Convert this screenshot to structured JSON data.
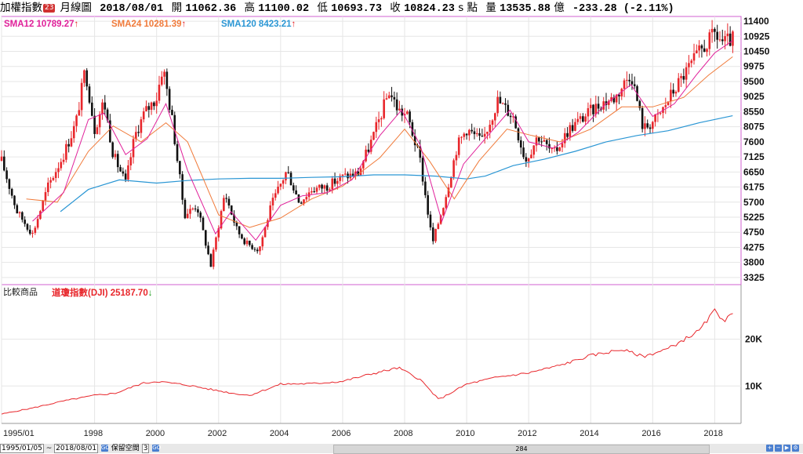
{
  "header": {
    "index_name": "加權指數",
    "badge": "23",
    "period": "月線圖",
    "date": "2018/08/01",
    "open_label": "開",
    "open": "11062.36",
    "high_label": "高",
    "high": "11100.02",
    "low_label": "低",
    "low": "10693.73",
    "close_label": "收",
    "close": "10824.23",
    "unit": "s 點",
    "volume_label": "量",
    "volume": "13535.88",
    "volume_unit": "億",
    "change": "-233.28 (-2.11%)"
  },
  "legend": {
    "sma12": "SMA12 10789.27",
    "sma24": "SMA24 10281.39",
    "sma120": "SMA120 8423.21",
    "arrow_up": "↑",
    "arrow_down": "↓",
    "compare_label": "比較商品",
    "compare_series": "道瓊指數(DJI) 25187.70"
  },
  "colors": {
    "up": "#e8262b",
    "down": "#111111",
    "sma12": "#e0209a",
    "sma24": "#f07a3a",
    "sma120": "#2a96d4",
    "dji": "#e8262b",
    "frame": "#d060d0",
    "arrow_up": "#e8262b",
    "arrow_down": "#1a9a1a"
  },
  "bottom": {
    "start_date": "1995/01/05",
    "tilde": "~",
    "end_date": "2018/08/01",
    "go": "GO",
    "keep_space_label": "保留空間",
    "keep_space_value": "3",
    "scroll_value": "284"
  },
  "chart_data": [
    {
      "type": "candlestick",
      "title": "加權指數 月線圖",
      "x_tick_labels": [
        "1995/01",
        "1998",
        "2000",
        "2002",
        "2004",
        "2006",
        "2008",
        "2010",
        "2012",
        "2014",
        "2016",
        "2018"
      ],
      "y_tick_labels": [
        "11400",
        "10925",
        "10450",
        "9975",
        "9500",
        "9025",
        "8550",
        "8075",
        "7600",
        "7125",
        "6650",
        "6175",
        "5700",
        "5225",
        "4750",
        "4275",
        "3800",
        "3325"
      ],
      "ylim": [
        3100,
        11550
      ],
      "series": [
        {
          "name": "SMA12",
          "value": 10789.27
        },
        {
          "name": "SMA24",
          "value": 10281.39
        },
        {
          "name": "SMA120",
          "value": 8423.21
        }
      ],
      "close_points": [
        {
          "x": 1995.0,
          "y": 7000
        },
        {
          "x": 1995.5,
          "y": 5400
        },
        {
          "x": 1996.0,
          "y": 4700
        },
        {
          "x": 1996.5,
          "y": 6200
        },
        {
          "x": 1997.0,
          "y": 7200
        },
        {
          "x": 1997.4,
          "y": 8200
        },
        {
          "x": 1997.7,
          "y": 9900
        },
        {
          "x": 1998.0,
          "y": 8000
        },
        {
          "x": 1998.3,
          "y": 8900
        },
        {
          "x": 1998.6,
          "y": 7200
        },
        {
          "x": 1999.0,
          "y": 6300
        },
        {
          "x": 1999.3,
          "y": 7800
        },
        {
          "x": 1999.6,
          "y": 8500
        },
        {
          "x": 2000.0,
          "y": 9000
        },
        {
          "x": 2000.2,
          "y": 10000
        },
        {
          "x": 2000.5,
          "y": 8300
        },
        {
          "x": 2000.9,
          "y": 5300
        },
        {
          "x": 2001.3,
          "y": 5600
        },
        {
          "x": 2001.75,
          "y": 3700
        },
        {
          "x": 2002.2,
          "y": 6000
        },
        {
          "x": 2002.6,
          "y": 4800
        },
        {
          "x": 2002.9,
          "y": 4400
        },
        {
          "x": 2003.3,
          "y": 4200
        },
        {
          "x": 2003.7,
          "y": 5600
        },
        {
          "x": 2004.2,
          "y": 6700
        },
        {
          "x": 2004.6,
          "y": 5700
        },
        {
          "x": 2005.0,
          "y": 6100
        },
        {
          "x": 2005.5,
          "y": 6200
        },
        {
          "x": 2006.0,
          "y": 6500
        },
        {
          "x": 2006.5,
          "y": 6600
        },
        {
          "x": 2007.0,
          "y": 7800
        },
        {
          "x": 2007.5,
          "y": 9200
        },
        {
          "x": 2007.8,
          "y": 8600
        },
        {
          "x": 2008.1,
          "y": 8400
        },
        {
          "x": 2008.5,
          "y": 7000
        },
        {
          "x": 2008.9,
          "y": 4400
        },
        {
          "x": 2009.3,
          "y": 5800
        },
        {
          "x": 2009.7,
          "y": 7500
        },
        {
          "x": 2010.0,
          "y": 8000
        },
        {
          "x": 2010.5,
          "y": 7600
        },
        {
          "x": 2011.0,
          "y": 8900
        },
        {
          "x": 2011.5,
          "y": 8400
        },
        {
          "x": 2011.9,
          "y": 7000
        },
        {
          "x": 2012.3,
          "y": 7800
        },
        {
          "x": 2012.8,
          "y": 7200
        },
        {
          "x": 2013.3,
          "y": 8000
        },
        {
          "x": 2013.8,
          "y": 8400
        },
        {
          "x": 2014.3,
          "y": 8800
        },
        {
          "x": 2014.8,
          "y": 9000
        },
        {
          "x": 2015.3,
          "y": 9800
        },
        {
          "x": 2015.7,
          "y": 8000
        },
        {
          "x": 2016.2,
          "y": 8400
        },
        {
          "x": 2016.6,
          "y": 9100
        },
        {
          "x": 2017.0,
          "y": 9700
        },
        {
          "x": 2017.5,
          "y": 10400
        },
        {
          "x": 2018.0,
          "y": 11000
        },
        {
          "x": 2018.3,
          "y": 10700
        },
        {
          "x": 2018.58,
          "y": 10824
        }
      ],
      "sma12_points": [
        {
          "x": 1996.0,
          "y": 5100
        },
        {
          "x": 1997.0,
          "y": 6000
        },
        {
          "x": 1997.8,
          "y": 8300
        },
        {
          "x": 1998.3,
          "y": 8500
        },
        {
          "x": 1999.0,
          "y": 7200
        },
        {
          "x": 1999.7,
          "y": 7700
        },
        {
          "x": 2000.3,
          "y": 8800
        },
        {
          "x": 2001.0,
          "y": 6700
        },
        {
          "x": 2001.9,
          "y": 4700
        },
        {
          "x": 2002.4,
          "y": 5400
        },
        {
          "x": 2003.2,
          "y": 4500
        },
        {
          "x": 2004.0,
          "y": 5600
        },
        {
          "x": 2004.7,
          "y": 5900
        },
        {
          "x": 2005.5,
          "y": 6000
        },
        {
          "x": 2006.3,
          "y": 6400
        },
        {
          "x": 2007.2,
          "y": 7800
        },
        {
          "x": 2007.9,
          "y": 8600
        },
        {
          "x": 2008.5,
          "y": 7500
        },
        {
          "x": 2009.2,
          "y": 5100
        },
        {
          "x": 2009.9,
          "y": 6900
        },
        {
          "x": 2010.6,
          "y": 7700
        },
        {
          "x": 2011.4,
          "y": 8600
        },
        {
          "x": 2012.0,
          "y": 7600
        },
        {
          "x": 2012.8,
          "y": 7400
        },
        {
          "x": 2013.6,
          "y": 7900
        },
        {
          "x": 2014.5,
          "y": 8800
        },
        {
          "x": 2015.3,
          "y": 9400
        },
        {
          "x": 2016.0,
          "y": 8400
        },
        {
          "x": 2016.7,
          "y": 8800
        },
        {
          "x": 2017.4,
          "y": 9700
        },
        {
          "x": 2018.0,
          "y": 10400
        },
        {
          "x": 2018.58,
          "y": 10789
        }
      ],
      "sma24_points": [
        {
          "x": 1995.8,
          "y": 5800
        },
        {
          "x": 1996.8,
          "y": 5700
        },
        {
          "x": 1997.8,
          "y": 7300
        },
        {
          "x": 1998.6,
          "y": 8100
        },
        {
          "x": 1999.5,
          "y": 7600
        },
        {
          "x": 2000.3,
          "y": 8200
        },
        {
          "x": 2001.0,
          "y": 7600
        },
        {
          "x": 2002.0,
          "y": 5300
        },
        {
          "x": 2003.0,
          "y": 4900
        },
        {
          "x": 2004.0,
          "y": 5200
        },
        {
          "x": 2005.0,
          "y": 5800
        },
        {
          "x": 2006.0,
          "y": 6200
        },
        {
          "x": 2007.2,
          "y": 7100
        },
        {
          "x": 2008.0,
          "y": 8000
        },
        {
          "x": 2008.8,
          "y": 7000
        },
        {
          "x": 2009.6,
          "y": 5800
        },
        {
          "x": 2010.4,
          "y": 7000
        },
        {
          "x": 2011.3,
          "y": 8000
        },
        {
          "x": 2012.1,
          "y": 7800
        },
        {
          "x": 2013.0,
          "y": 7600
        },
        {
          "x": 2014.0,
          "y": 8000
        },
        {
          "x": 2015.0,
          "y": 8700
        },
        {
          "x": 2016.0,
          "y": 8700
        },
        {
          "x": 2017.0,
          "y": 9000
        },
        {
          "x": 2017.8,
          "y": 9700
        },
        {
          "x": 2018.58,
          "y": 10281
        }
      ],
      "sma120_points": [
        {
          "x": 1996.9,
          "y": 5400
        },
        {
          "x": 1997.8,
          "y": 6100
        },
        {
          "x": 1998.8,
          "y": 6400
        },
        {
          "x": 2000.0,
          "y": 6300
        },
        {
          "x": 2001.0,
          "y": 6380
        },
        {
          "x": 2002.0,
          "y": 6430
        },
        {
          "x": 2003.0,
          "y": 6450
        },
        {
          "x": 2004.0,
          "y": 6450
        },
        {
          "x": 2005.0,
          "y": 6480
        },
        {
          "x": 2006.0,
          "y": 6500
        },
        {
          "x": 2007.0,
          "y": 6560
        },
        {
          "x": 2008.0,
          "y": 6560
        },
        {
          "x": 2009.0,
          "y": 6520
        },
        {
          "x": 2010.0,
          "y": 6430
        },
        {
          "x": 2010.6,
          "y": 6520
        },
        {
          "x": 2011.5,
          "y": 6850
        },
        {
          "x": 2012.5,
          "y": 7050
        },
        {
          "x": 2013.5,
          "y": 7300
        },
        {
          "x": 2014.5,
          "y": 7600
        },
        {
          "x": 2015.5,
          "y": 7800
        },
        {
          "x": 2016.5,
          "y": 7950
        },
        {
          "x": 2017.5,
          "y": 8200
        },
        {
          "x": 2018.58,
          "y": 8423
        }
      ]
    },
    {
      "type": "line",
      "title": "比較商品 道瓊指數(DJI)",
      "y_tick_labels": [
        "20K",
        "10K"
      ],
      "ylim": [
        2000,
        29000
      ],
      "series": [
        {
          "name": "道瓊指數(DJI)",
          "points": [
            {
              "x": 1995.0,
              "y": 4000
            },
            {
              "x": 1996.0,
              "y": 5300
            },
            {
              "x": 1997.0,
              "y": 6800
            },
            {
              "x": 1998.0,
              "y": 8000
            },
            {
              "x": 1998.7,
              "y": 8500
            },
            {
              "x": 1999.5,
              "y": 10500
            },
            {
              "x": 2000.0,
              "y": 11000
            },
            {
              "x": 2001.0,
              "y": 10200
            },
            {
              "x": 2001.8,
              "y": 9200
            },
            {
              "x": 2002.5,
              "y": 8400
            },
            {
              "x": 2003.0,
              "y": 8000
            },
            {
              "x": 2004.0,
              "y": 10400
            },
            {
              "x": 2005.0,
              "y": 10500
            },
            {
              "x": 2006.0,
              "y": 11000
            },
            {
              "x": 2007.0,
              "y": 12700
            },
            {
              "x": 2007.8,
              "y": 13900
            },
            {
              "x": 2008.5,
              "y": 11400
            },
            {
              "x": 2009.1,
              "y": 7100
            },
            {
              "x": 2010.0,
              "y": 10400
            },
            {
              "x": 2011.0,
              "y": 11900
            },
            {
              "x": 2012.0,
              "y": 12800
            },
            {
              "x": 2013.0,
              "y": 14400
            },
            {
              "x": 2014.0,
              "y": 16500
            },
            {
              "x": 2015.0,
              "y": 17800
            },
            {
              "x": 2015.7,
              "y": 16300
            },
            {
              "x": 2016.5,
              "y": 18000
            },
            {
              "x": 2017.0,
              "y": 19900
            },
            {
              "x": 2017.5,
              "y": 21800
            },
            {
              "x": 2018.0,
              "y": 26100
            },
            {
              "x": 2018.3,
              "y": 24100
            },
            {
              "x": 2018.58,
              "y": 25187
            }
          ]
        }
      ]
    }
  ]
}
